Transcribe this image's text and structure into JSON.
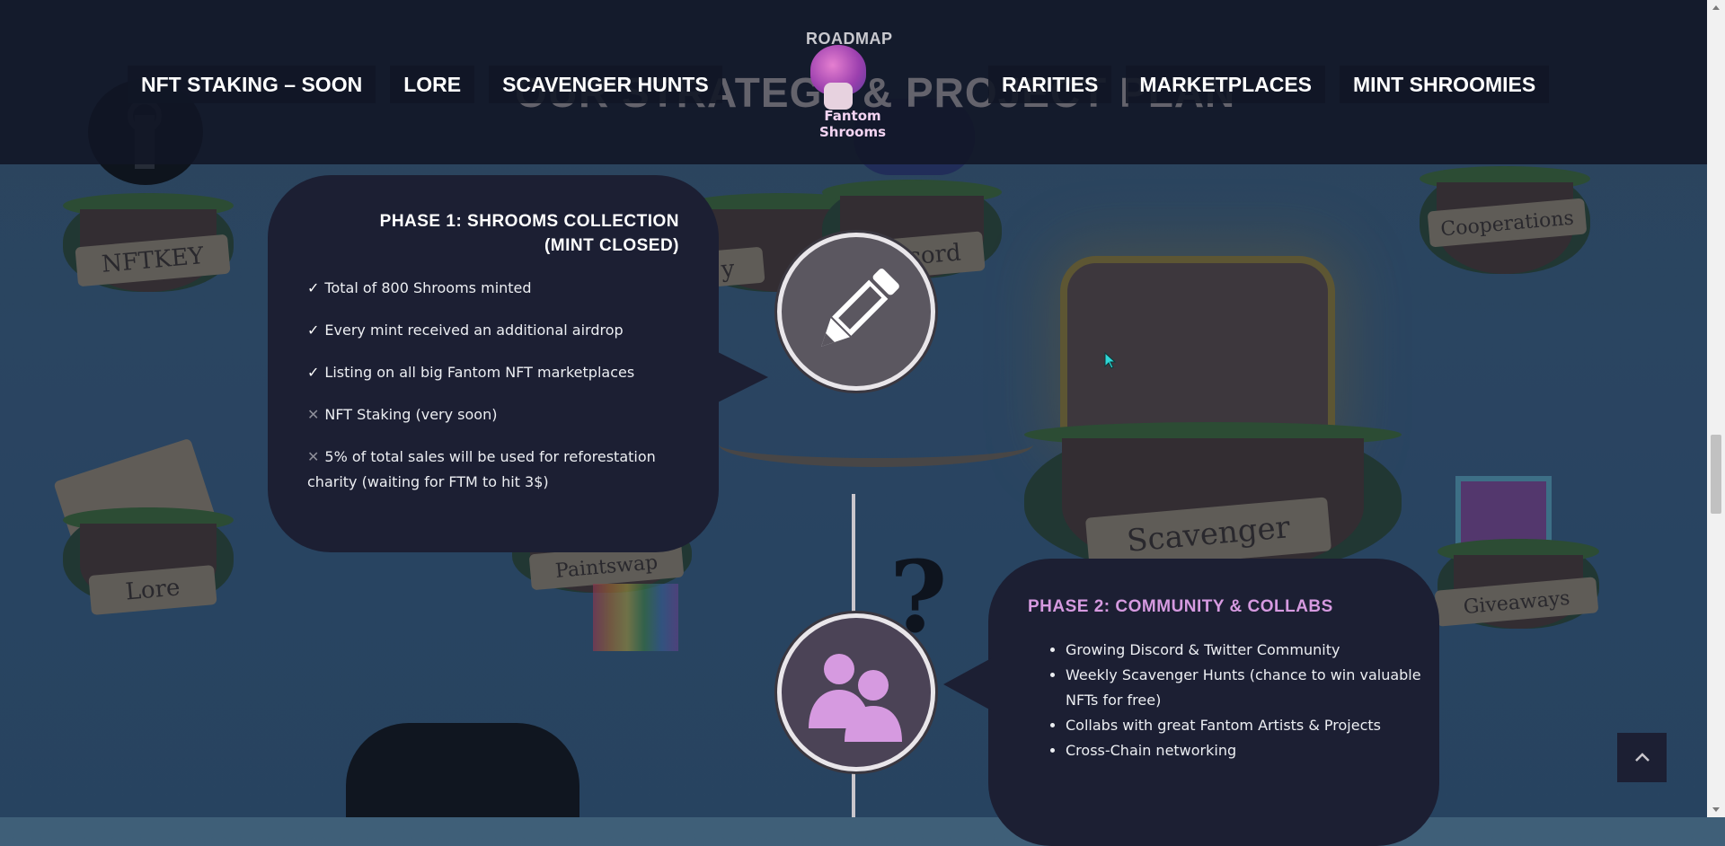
{
  "header": {
    "section_label": "ROADMAP",
    "background_title": "OUR STRATEGY & PROJECT PLAN",
    "logo_text": "Fantom Shrooms",
    "nav_left": [
      {
        "label": "NFT STAKING – SOON"
      },
      {
        "label": "LORE"
      },
      {
        "label": "SCAVENGER HUNTS"
      }
    ],
    "nav_right": [
      {
        "label": "RARITIES"
      },
      {
        "label": "MARKETPLACES"
      },
      {
        "label": "MINT SHROOMIES"
      }
    ]
  },
  "scene": {
    "banners": {
      "nftkey": "NFTKEY",
      "lore": "Lore",
      "paintswap": "Paintswap",
      "discord": "cord",
      "cooperations": "Cooperations",
      "scavenger": "Scavenger",
      "giveaways": "Giveaways",
      "misc": "y"
    }
  },
  "phases": [
    {
      "title": "PHASE 1: SHROOMS COLLECTION (MINT CLOSED)",
      "icon": "pencil-icon",
      "items": [
        {
          "status": "done",
          "mark": "✓",
          "text": "Total of 800 Shrooms minted"
        },
        {
          "status": "done",
          "mark": "✓",
          "text": "Every mint received an additional airdrop"
        },
        {
          "status": "done",
          "mark": "✓",
          "text": "Listing on all big Fantom NFT marketplaces"
        },
        {
          "status": "todo",
          "mark": "✕",
          "text": "NFT Staking (very soon)"
        },
        {
          "status": "todo",
          "mark": "✕",
          "text": "5% of total sales will be used for reforestation charity (waiting for FTM to hit 3$)"
        }
      ]
    },
    {
      "title": "PHASE 2: COMMUNITY & COLLABS",
      "icon": "users-icon",
      "items": [
        "Growing Discord & Twitter Community",
        "Weekly Scavenger Hunts (chance to win valuable NFTs for free)",
        "Collabs with great Fantom Artists & Projects",
        "Cross-Chain networking"
      ]
    }
  ],
  "colors": {
    "card_bg": "#1c1f33",
    "phase2_accent": "#d69ae0",
    "header_bg": "#111626"
  },
  "scroll_top_icon": "chevron-up-icon"
}
